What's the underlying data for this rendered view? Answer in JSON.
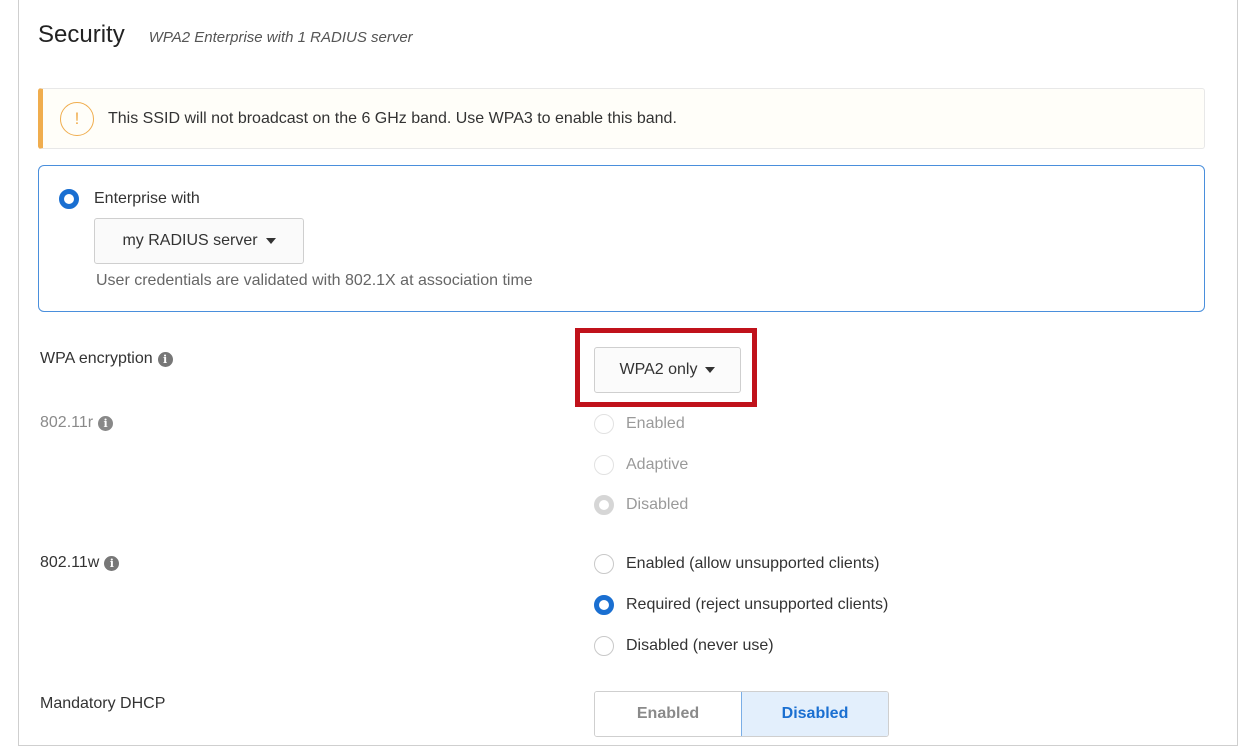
{
  "header": {
    "title": "Security",
    "subtitle": "WPA2 Enterprise with 1 RADIUS server"
  },
  "alert": {
    "icon": "warning-icon",
    "text": "This SSID will not broadcast on the 6 GHz band. Use WPA3 to enable this band.",
    "color": "#f0ad4e"
  },
  "enterprise": {
    "label": "Enterprise with",
    "selected": true,
    "radius_server": "my RADIUS server",
    "help": "User credentials are validated with 802.1X at association time",
    "accent": "#1a6fd1"
  },
  "wpa_encryption": {
    "label": "WPA encryption",
    "value": "WPA2 only",
    "highlight_color": "#c0121b"
  },
  "dot11r": {
    "label": "802.11r",
    "disabled": true,
    "options": [
      "Enabled",
      "Adaptive",
      "Disabled"
    ],
    "selected": "Disabled"
  },
  "dot11w": {
    "label": "802.11w",
    "options": [
      "Enabled (allow unsupported clients)",
      "Required (reject unsupported clients)",
      "Disabled (never use)"
    ],
    "selected": "Required (reject unsupported clients)"
  },
  "mandatory_dhcp": {
    "label": "Mandatory DHCP",
    "options": [
      "Enabled",
      "Disabled"
    ],
    "selected": "Disabled"
  }
}
